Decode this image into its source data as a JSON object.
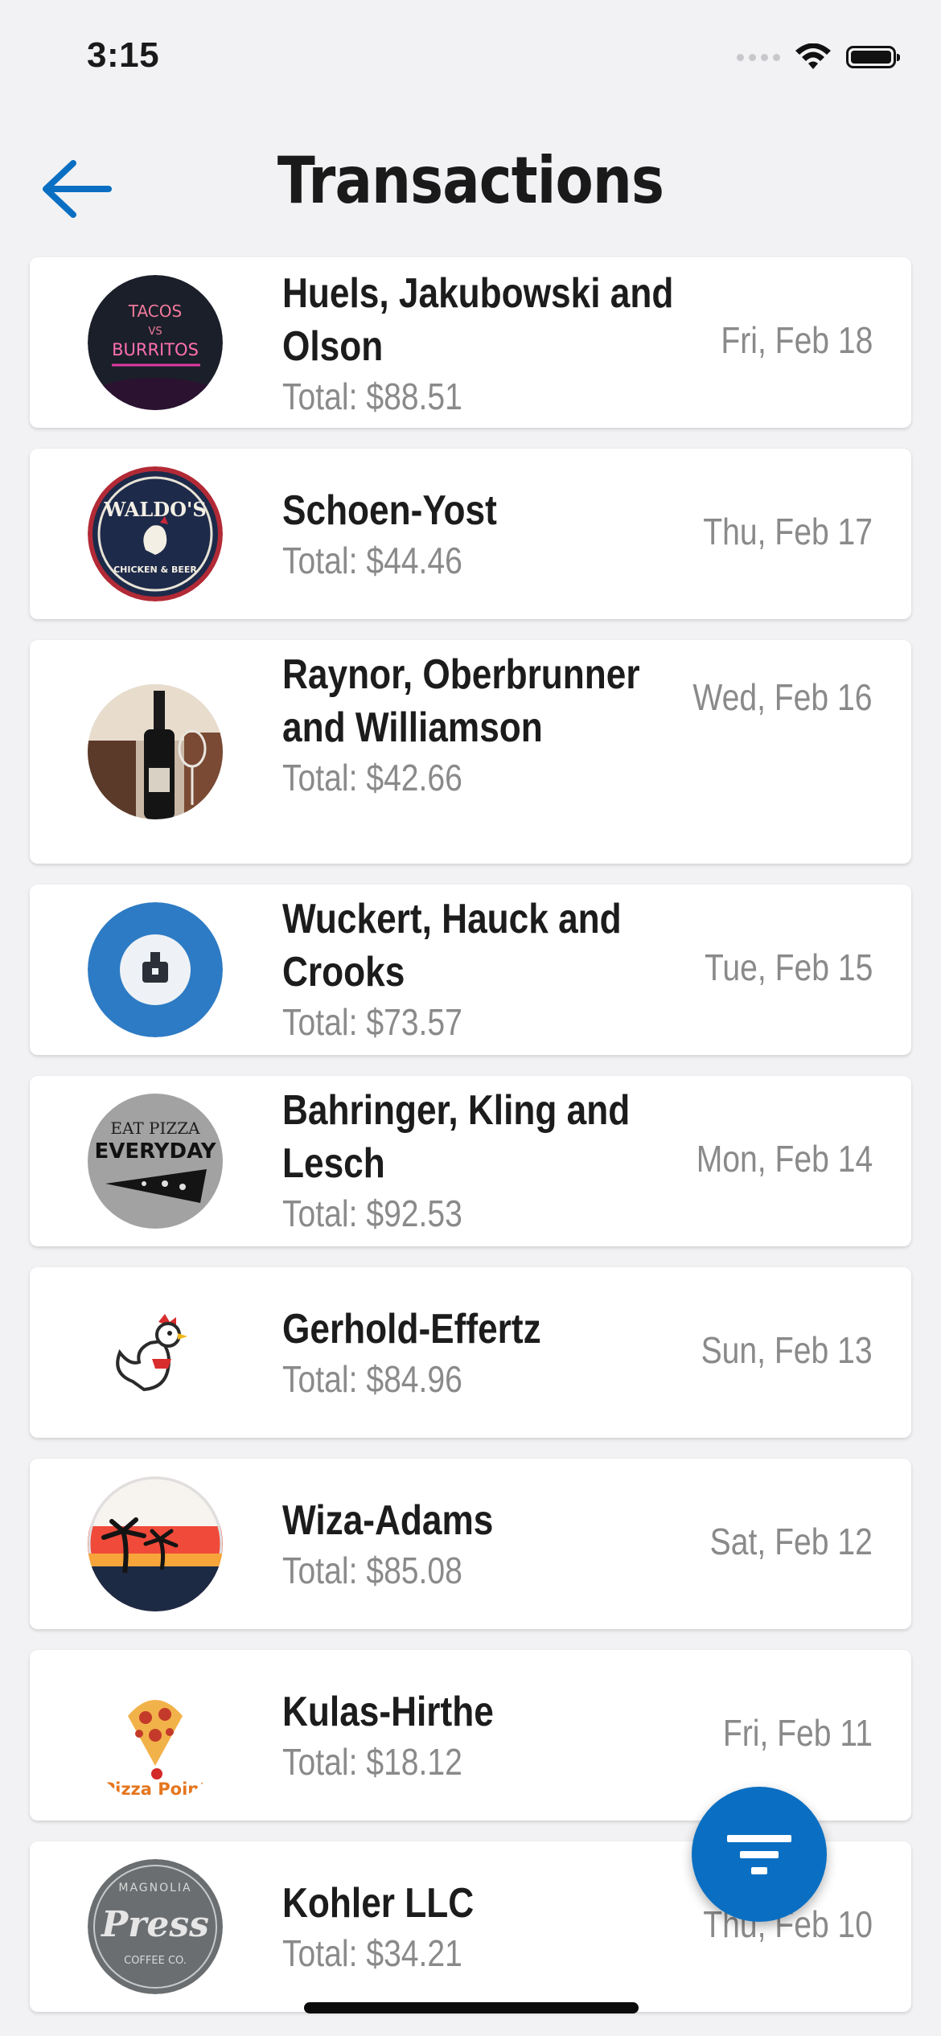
{
  "status_bar": {
    "time": "3:15"
  },
  "header": {
    "title": "Transactions"
  },
  "transactions": [
    {
      "merchant": "Huels, Jakubowski and Olson",
      "total": "Total: $88.51",
      "date": "Fri, Feb 18",
      "logo": "tacos-vs-burritos-logo"
    },
    {
      "merchant": "Schoen-Yost",
      "total": "Total: $44.46",
      "date": "Thu, Feb 17",
      "logo": "waldos-chicken-beer-logo"
    },
    {
      "merchant": "Raynor, Oberbrunner and Williamson",
      "total": "Total: $42.66",
      "date": "Wed, Feb 16",
      "logo": "wine-bottle-photo"
    },
    {
      "merchant": "Wuckert, Hauck and Crooks",
      "total": "Total: $73.57",
      "date": "Tue, Feb 15",
      "logo": "blue-circle-logo"
    },
    {
      "merchant": "Bahringer, Kling and Lesch",
      "total": "Total: $92.53",
      "date": "Mon, Feb 14",
      "logo": "eat-pizza-everyday-logo"
    },
    {
      "merchant": "Gerhold-Effertz",
      "total": "Total: $84.96",
      "date": "Sun, Feb 13",
      "logo": "rooster-logo"
    },
    {
      "merchant": "Wiza-Adams",
      "total": "Total: $85.08",
      "date": "Sat, Feb 12",
      "logo": "palm-sunset-logo"
    },
    {
      "merchant": "Kulas-Hirthe",
      "total": "Total: $18.12",
      "date": "Fri, Feb 11",
      "logo": "pizza-point-logo"
    },
    {
      "merchant": "Kohler LLC",
      "total": "Total: $34.21",
      "date": "Thu, Feb 10",
      "logo": "magnolia-press-logo"
    }
  ],
  "logo_text": {
    "tacos_top": "TACOS",
    "tacos_vs": "VS",
    "tacos_bottom": "BURRITOS",
    "waldos": "WALDO'S",
    "waldos_sub": "CHICKEN & BEER",
    "eat_pizza": "EAT PIZZA",
    "everyday": "EVERYDAY",
    "pizza_point": "Pizza Point",
    "magnolia": "MAGNOLIA",
    "press": "Press",
    "coffee": "COFFEE CO."
  },
  "colors": {
    "accent": "#0a6fc2",
    "background": "#f2f2f4",
    "card": "#ffffff",
    "secondary_text": "#8a8a8a"
  },
  "icons": {
    "back": "arrow-left-icon",
    "filter": "filter-icon"
  }
}
